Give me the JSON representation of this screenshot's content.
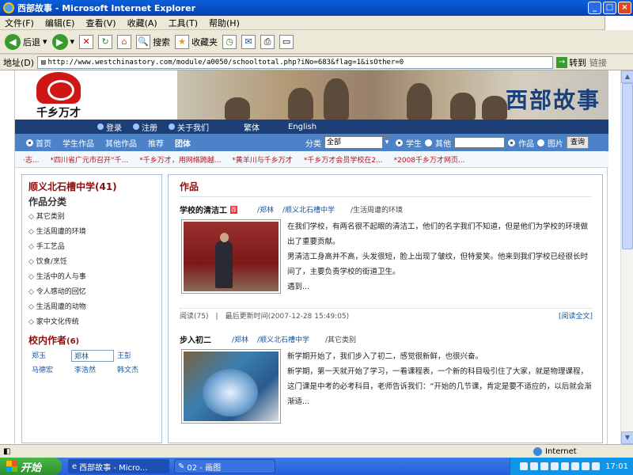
{
  "window": {
    "title": "西部故事 - Microsoft Internet Explorer",
    "min": "_",
    "max": "□",
    "close": "×"
  },
  "menu": [
    "文件(F)",
    "编辑(E)",
    "查看(V)",
    "收藏(A)",
    "工具(T)",
    "帮助(H)"
  ],
  "toolbar": {
    "back": "后退",
    "search": "搜索",
    "favorites": "收藏夹"
  },
  "address": {
    "label": "地址(D)",
    "url": "http://www.westchinastory.com/module/a0050/schooltotal.php?iNo=683&flag=1&isOther=0",
    "go": "转到",
    "links": "链接"
  },
  "site": {
    "logo_text": "千乡万才",
    "banner_title": "西部故事",
    "nav_top": {
      "login": "登录",
      "register": "注册",
      "about": "关于我们",
      "trad": "繁体",
      "english": "English"
    },
    "nav_main": {
      "home": "首页",
      "student_works": "学生作品",
      "other_works": "其他作品",
      "recommend": "推荐",
      "group": "团体",
      "category": "分类",
      "category_value": "全部",
      "radio_student": "学生",
      "radio_other": "其他",
      "radio_work": "作品",
      "radio_image": "图片",
      "search_btn": "查询"
    },
    "ticker": [
      "·志...",
      "*四川省广元市召开“千...",
      "*千乡万才，用网络跨越...",
      "*黄羊川与千乡万才",
      "*千乡万才会员学校在2...",
      "*2008千乡万才网页..."
    ]
  },
  "sidebar": {
    "school": "顺义北石槽中学(41)",
    "cat_title": "作品分类",
    "categories": [
      "其它类别",
      "生活周遭的环境",
      "手工艺品",
      "饮食/烹饪",
      "生活中的人与事",
      "令人感动的回忆",
      "生活周遭的动物",
      "家中文化传统"
    ],
    "authors_title": "校内作者",
    "authors_count": "(6)",
    "authors": [
      "郑玉",
      "郑林",
      "王彭",
      "马德宏",
      "李浩然",
      "韩文杰"
    ]
  },
  "main": {
    "heading": "作品",
    "articles": [
      {
        "title": "学校的清洁工",
        "badge": "荐",
        "author": "/郑林",
        "school": "/顺义北石槽中学",
        "category": "/生活周遭的环境",
        "body": [
          "在我们学校，有两名很不起眼的清洁工，他们的名字我们不知道，但是他们为学校的环境做出了重要贡献。",
          "男清洁工身高并不高，头发很短，脸上出现了皱纹，但特爱笑。他来到我们学校已经很长时间了，主要负责学校的街道卫生。",
          "遇到..."
        ],
        "reads": "阅读(75)",
        "sep": "|",
        "updated": "最后更新时间(2007-12-28 15:49:05)",
        "more": "[阅读全文]"
      },
      {
        "title": "步入初二",
        "author": "/郑林",
        "school": "/顺义北石槽中学",
        "category": "/其它类别",
        "body": [
          "新学期开始了，我们步入了初二，感觉很新鲜，也很兴奋。",
          "新学期，第一天就开始了学习，一看课程表，一个新的科目吸引住了大家，就是物理课程，这门课是中考的必考科目，老师告诉我们：“开始的几节课，肯定是要不适应的，以后就会渐渐适..."
        ]
      }
    ]
  },
  "status": {
    "zone": "Internet"
  },
  "taskbar": {
    "start": "开始",
    "task1": "西部故事 - Micro...",
    "task2": "02 - 画图",
    "clock": "17:01"
  },
  "colors": {
    "nav_dark": "#1c3f78",
    "nav_light": "#4b82c8",
    "accent_red": "#8a1010",
    "link_blue": "#1a55a0"
  }
}
